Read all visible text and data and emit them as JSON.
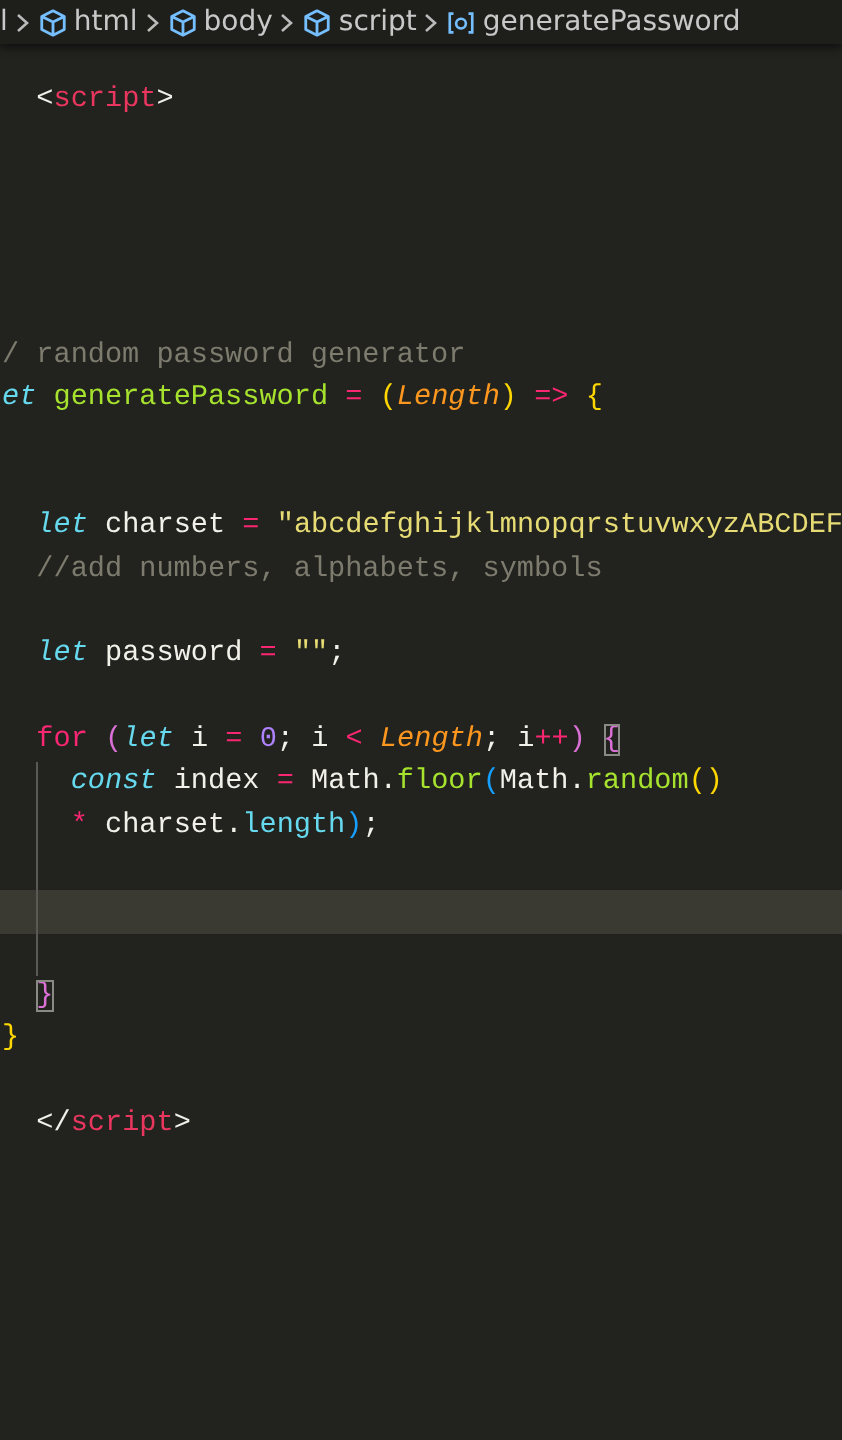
{
  "breadcrumb": [
    {
      "kind": "fragment",
      "label": "l"
    },
    {
      "kind": "element",
      "label": "html"
    },
    {
      "kind": "element",
      "label": "body"
    },
    {
      "kind": "element",
      "label": "script"
    },
    {
      "kind": "variable",
      "label": "generatePassword"
    }
  ],
  "lines": [
    {
      "current": false,
      "guide": false,
      "tokens": [
        {
          "kind": "plain",
          "text": "  <"
        },
        {
          "kind": "tag",
          "text": "script"
        },
        {
          "kind": "plain",
          "text": ">"
        }
      ]
    },
    {
      "current": false,
      "guide": false
    },
    {
      "current": false,
      "guide": false
    },
    {
      "current": false,
      "guide": false
    },
    {
      "current": false,
      "guide": false
    },
    {
      "current": false,
      "guide": false
    },
    {
      "current": false,
      "guide": false,
      "tokens": [
        {
          "kind": "comment",
          "text": "/ random password generator"
        }
      ]
    },
    {
      "current": false,
      "guide": false,
      "tokens": [
        {
          "kind": "keyword",
          "text": "et"
        },
        {
          "kind": "function",
          "text": " generatePassword"
        },
        {
          "kind": "operator",
          "text": " ="
        },
        {
          "kind": "bracket1",
          "text": " ("
        },
        {
          "kind": "param",
          "text": "Length"
        },
        {
          "kind": "bracket1",
          "text": ")"
        },
        {
          "kind": "operator",
          "text": " =>"
        },
        {
          "kind": "bracket1",
          "text": " {"
        }
      ]
    },
    {
      "current": false,
      "guide": false
    },
    {
      "current": false,
      "guide": false
    },
    {
      "current": false,
      "guide": false,
      "tokens": [
        {
          "kind": "keyword",
          "text": "  let"
        },
        {
          "kind": "plain",
          "text": " charset"
        },
        {
          "kind": "operator",
          "text": " ="
        },
        {
          "kind": "string",
          "text": " \"abcdefghijklmnopqrstuvwxyzABCDEF"
        }
      ]
    },
    {
      "current": false,
      "guide": false,
      "tokens": [
        {
          "kind": "comment",
          "text": "  //add numbers, alphabets, symbols"
        }
      ]
    },
    {
      "current": false,
      "guide": false
    },
    {
      "current": false,
      "guide": false,
      "tokens": [
        {
          "kind": "keyword",
          "text": "  let"
        },
        {
          "kind": "plain",
          "text": " password"
        },
        {
          "kind": "operator",
          "text": " ="
        },
        {
          "kind": "string",
          "text": " \"\""
        },
        {
          "kind": "plain",
          "text": ";"
        }
      ]
    },
    {
      "current": false,
      "guide": false
    },
    {
      "current": false,
      "guide": false,
      "tokens": [
        {
          "kind": "control",
          "text": "  for"
        },
        {
          "kind": "bracket2",
          "text": " ("
        },
        {
          "kind": "keyword",
          "text": "let"
        },
        {
          "kind": "plain",
          "text": " i"
        },
        {
          "kind": "operator",
          "text": " ="
        },
        {
          "kind": "number",
          "text": " 0"
        },
        {
          "kind": "plain",
          "text": "; i"
        },
        {
          "kind": "operator",
          "text": " <"
        },
        {
          "kind": "param",
          "text": " Length"
        },
        {
          "kind": "plain",
          "text": "; i"
        },
        {
          "kind": "operator",
          "text": "++"
        },
        {
          "kind": "bracket2",
          "text": ")"
        },
        {
          "kind": "bracket2-match",
          "text": " {"
        }
      ]
    },
    {
      "current": false,
      "guide": true,
      "tokens": [
        {
          "kind": "keyword",
          "text": "    const"
        },
        {
          "kind": "plain",
          "text": " index"
        },
        {
          "kind": "operator",
          "text": " ="
        },
        {
          "kind": "plain",
          "text": " Math."
        },
        {
          "kind": "function",
          "text": "floor"
        },
        {
          "kind": "bracket3",
          "text": "("
        },
        {
          "kind": "plain",
          "text": "Math."
        },
        {
          "kind": "function",
          "text": "random"
        },
        {
          "kind": "bracket1",
          "text": "()"
        }
      ]
    },
    {
      "current": false,
      "guide": true,
      "tokens": [
        {
          "kind": "operator",
          "text": "    *"
        },
        {
          "kind": "plain",
          "text": " charset."
        },
        {
          "kind": "property",
          "text": "length"
        },
        {
          "kind": "bracket3",
          "text": ")"
        },
        {
          "kind": "plain",
          "text": ";"
        }
      ]
    },
    {
      "current": false,
      "guide": true
    },
    {
      "current": true,
      "guide": true
    },
    {
      "current": false,
      "guide": true
    },
    {
      "current": false,
      "guide": false,
      "tokens": [
        {
          "kind": "bracket2-match",
          "text": "  }"
        }
      ]
    },
    {
      "current": false,
      "guide": false,
      "tokens": [
        {
          "kind": "bracket1",
          "text": "}"
        }
      ]
    },
    {
      "current": false,
      "guide": false
    },
    {
      "current": false,
      "guide": false,
      "tokens": [
        {
          "kind": "plain",
          "text": "  </"
        },
        {
          "kind": "tag",
          "text": "script"
        },
        {
          "kind": "plain",
          "text": ">"
        }
      ]
    }
  ]
}
